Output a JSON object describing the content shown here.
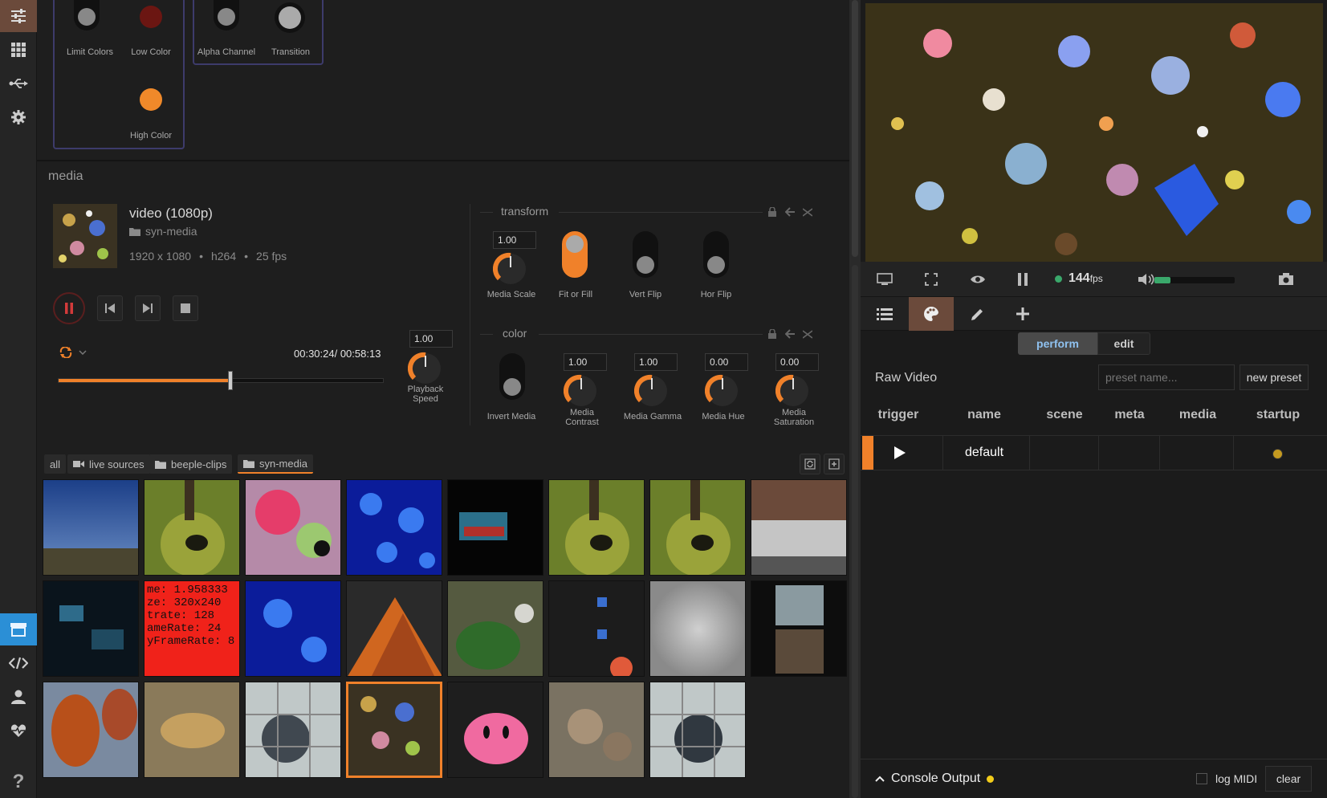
{
  "colors": {
    "accent": "#f0812a",
    "group_border": "#3d3b6b",
    "active_blue": "#2b8fd6",
    "status_green": "#3aa86b"
  },
  "top_controls": {
    "limit_colors": "Limit Colors",
    "low_color": "Low Color",
    "high_color": "High Color",
    "alpha_channel": "Alpha Channel",
    "transition": "Transition"
  },
  "media": {
    "section_title": "media",
    "clip_title": "video (1080p)",
    "folder": "syn-media",
    "resolution": "1920 x 1080",
    "codec": "h264",
    "fps": "25 fps",
    "time": "00:30:24/ 00:58:13",
    "progress": 0.53,
    "playback_speed_value": "1.00",
    "playback_speed_label1": "Playback",
    "playback_speed_label2": "Speed"
  },
  "transform": {
    "title": "transform",
    "media_scale_value": "1.00",
    "media_scale": "Media Scale",
    "fit_or_fill": "Fit or Fill",
    "vert_flip": "Vert Flip",
    "hor_flip": "Hor Flip"
  },
  "color": {
    "title": "color",
    "invert_media": "Invert Media",
    "contrast_value": "1.00",
    "contrast_l1": "Media",
    "contrast_l2": "Contrast",
    "gamma_value": "1.00",
    "gamma": "Media Gamma",
    "hue_value": "0.00",
    "hue": "Media Hue",
    "saturation_value": "0.00",
    "saturation_l1": "Media",
    "saturation_l2": "Saturation"
  },
  "library_tabs": [
    "all",
    "live sources",
    "beeple-clips",
    "syn-media"
  ],
  "right": {
    "fps": "144",
    "fps_unit": "fps",
    "volume": 0.2,
    "seg_perform": "perform",
    "seg_edit": "edit",
    "source_label": "Raw Video",
    "preset_placeholder": "preset name...",
    "new_preset": "new preset",
    "columns": [
      "trigger",
      "name",
      "scene",
      "meta",
      "media",
      "startup"
    ],
    "row_name": "default",
    "console": "Console Output",
    "log_midi": "log MIDI",
    "clear": "clear"
  }
}
